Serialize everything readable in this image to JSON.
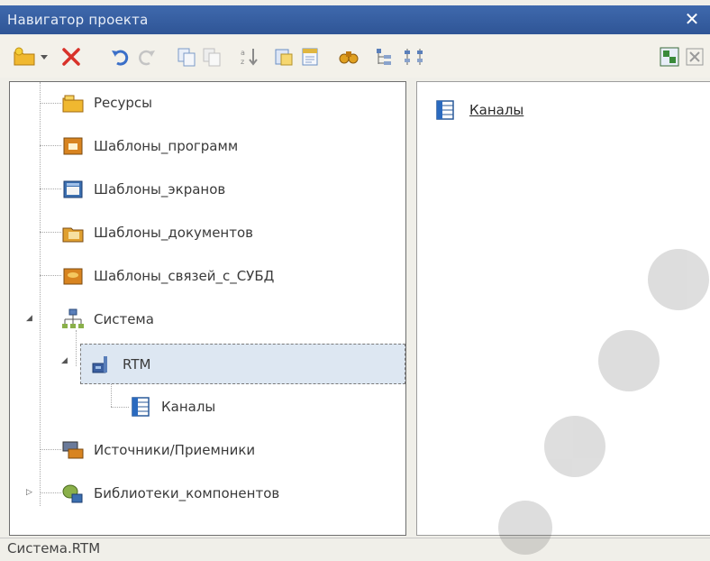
{
  "window": {
    "title": "Навигатор проекта",
    "close_label": "✕"
  },
  "toolbar": {
    "buttons": [
      "create-icon",
      "dropdown-icon",
      "delete-icon",
      "undo-icon",
      "redo-icon",
      "copy-icon",
      "paste-icon",
      "sort-icon",
      "properties-icon",
      "edit-icon",
      "find-icon",
      "expand-tree-icon",
      "collapse-tree-icon",
      "view-icon",
      "close-view-icon"
    ]
  },
  "tree": {
    "items": [
      {
        "label": "Ресурсы",
        "icon": "resources-icon"
      },
      {
        "label": "Шаблоны_программ",
        "icon": "program-templates-icon"
      },
      {
        "label": "Шаблоны_экранов",
        "icon": "screen-templates-icon"
      },
      {
        "label": "Шаблоны_документов",
        "icon": "document-templates-icon"
      },
      {
        "label": "Шаблоны_связей_с_СУБД",
        "icon": "dbms-templates-icon"
      },
      {
        "label": "Система",
        "icon": "system-icon",
        "expanded": true
      },
      {
        "label": "RTM",
        "icon": "rtm-icon",
        "expanded": true,
        "selected": true
      },
      {
        "label": "Каналы",
        "icon": "channels-icon"
      },
      {
        "label": "Источники/Приемники",
        "icon": "sources-icon"
      },
      {
        "label": "Библиотеки_компонентов",
        "icon": "libraries-icon",
        "collapsed": true
      }
    ]
  },
  "content": {
    "items": [
      {
        "label": "Каналы",
        "icon": "channels-icon"
      }
    ]
  },
  "status": {
    "text": "Система.RTM"
  }
}
